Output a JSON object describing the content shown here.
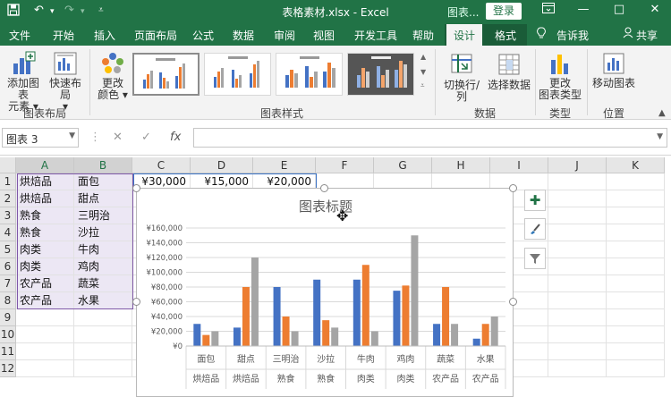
{
  "window": {
    "doc_title": "表格素材.xlsx  -  Excel",
    "tools_label": "图表...",
    "login_label": "登录"
  },
  "tabs": [
    "文件",
    "开始",
    "插入",
    "页面布局",
    "公式",
    "数据",
    "审阅",
    "视图",
    "开发工具",
    "帮助",
    "设计",
    "格式"
  ],
  "active_tab": "设计",
  "tell_me": "告诉我",
  "share": "共享",
  "ribbon": {
    "add_element": [
      "添加图表",
      "元素 ▾"
    ],
    "quick_layout": [
      "快速布局",
      "▾"
    ],
    "change_colors": [
      "更改",
      "颜色 ▾"
    ],
    "switch_row_col": "切换行/列",
    "select_data": "选择数据",
    "change_type": [
      "更改",
      "图表类型"
    ],
    "move_chart": "移动图表",
    "groups": {
      "layout": "图表布局",
      "styles": "图表样式",
      "data": "数据",
      "type": "类型",
      "location": "位置"
    }
  },
  "name_box": "图表 3",
  "formula_value": "",
  "columns": [
    "A",
    "B",
    "C",
    "D",
    "E",
    "F",
    "G",
    "H",
    "I",
    "J",
    "K"
  ],
  "rows": [
    "1",
    "2",
    "3",
    "4",
    "5",
    "6",
    "7",
    "8",
    "9",
    "10",
    "11",
    "12"
  ],
  "cells": {
    "A": [
      "烘焙品",
      "烘焙品",
      "熟食",
      "熟食",
      "肉类",
      "肉类",
      "农产品",
      "农产品"
    ],
    "B": [
      "面包",
      "甜点",
      "三明治",
      "沙拉",
      "牛肉",
      "鸡肉",
      "蔬菜",
      "水果"
    ],
    "C1": "¥30,000",
    "D1": "¥15,000",
    "E1": "¥20,000"
  },
  "chart_data": {
    "type": "bar",
    "title": "图表标题",
    "categories": [
      "面包",
      "甜点",
      "三明治",
      "沙拉",
      "牛肉",
      "鸡肉",
      "蔬菜",
      "水果"
    ],
    "groups": [
      "烘焙品",
      "烘焙品",
      "熟食",
      "熟食",
      "肉类",
      "肉类",
      "农产品",
      "农产品"
    ],
    "series": [
      {
        "values": [
          30000,
          25000,
          80000,
          90000,
          90000,
          75000,
          30000,
          10000
        ],
        "color": "#4472c4"
      },
      {
        "values": [
          15000,
          80000,
          40000,
          35000,
          110000,
          82000,
          80000,
          30000
        ],
        "color": "#ed7d31"
      },
      {
        "values": [
          20000,
          120000,
          20000,
          25000,
          20000,
          150000,
          30000,
          40000
        ],
        "color": "#a5a5a5"
      }
    ],
    "yticks": [
      "¥0",
      "¥20,000",
      "¥40,000",
      "¥60,000",
      "¥80,000",
      "¥100,000",
      "¥120,000",
      "¥140,000",
      "¥160,000"
    ],
    "ylim": [
      0,
      160000
    ],
    "grid": true
  }
}
